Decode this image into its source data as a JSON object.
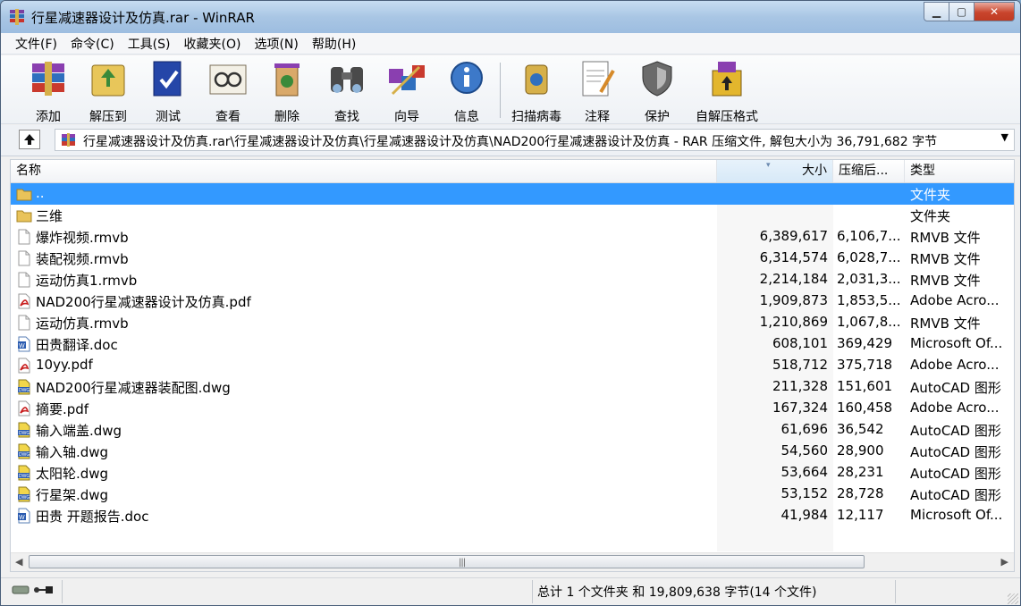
{
  "window": {
    "title": "行星减速器设计及仿真.rar - WinRAR"
  },
  "menu": [
    "文件(F)",
    "命令(C)",
    "工具(S)",
    "收藏夹(O)",
    "选项(N)",
    "帮助(H)"
  ],
  "toolbar": [
    {
      "label": "添加",
      "icon": "add-archive-icon"
    },
    {
      "label": "解压到",
      "icon": "extract-to-icon"
    },
    {
      "label": "测试",
      "icon": "test-icon"
    },
    {
      "label": "查看",
      "icon": "view-icon"
    },
    {
      "label": "删除",
      "icon": "delete-icon"
    },
    {
      "label": "查找",
      "icon": "find-icon"
    },
    {
      "label": "向导",
      "icon": "wizard-icon"
    },
    {
      "label": "信息",
      "icon": "info-icon"
    },
    {
      "label": "扫描病毒",
      "icon": "virus-scan-icon"
    },
    {
      "label": "注释",
      "icon": "comment-icon"
    },
    {
      "label": "保护",
      "icon": "protect-icon"
    },
    {
      "label": "自解压格式",
      "icon": "sfx-icon"
    }
  ],
  "address": {
    "path": "行星减速器设计及仿真.rar\\行星减速器设计及仿真\\行星减速器设计及仿真\\NAD200行星减速器设计及仿真 - RAR 压缩文件, 解包大小为 36,791,682 字节"
  },
  "columns": {
    "name": "名称",
    "size": "大小",
    "packed": "压缩后...",
    "type": "类型"
  },
  "files": [
    {
      "name": "..",
      "size": "",
      "packed": "",
      "type": "文件夹",
      "icon": "folder",
      "selected": true
    },
    {
      "name": "三维",
      "size": "",
      "packed": "",
      "type": "文件夹",
      "icon": "folder"
    },
    {
      "name": "爆炸视频.rmvb",
      "size": "6,389,617",
      "packed": "6,106,7...",
      "type": "RMVB 文件",
      "icon": "file"
    },
    {
      "name": "装配视频.rmvb",
      "size": "6,314,574",
      "packed": "6,028,7...",
      "type": "RMVB 文件",
      "icon": "file"
    },
    {
      "name": "运动仿真1.rmvb",
      "size": "2,214,184",
      "packed": "2,031,3...",
      "type": "RMVB 文件",
      "icon": "file"
    },
    {
      "name": "NAD200行星减速器设计及仿真.pdf",
      "size": "1,909,873",
      "packed": "1,853,5...",
      "type": "Adobe Acro...",
      "icon": "pdf"
    },
    {
      "name": "运动仿真.rmvb",
      "size": "1,210,869",
      "packed": "1,067,8...",
      "type": "RMVB 文件",
      "icon": "file"
    },
    {
      "name": "田贵翻译.doc",
      "size": "608,101",
      "packed": "369,429",
      "type": "Microsoft Of...",
      "icon": "doc"
    },
    {
      "name": "10yy.pdf",
      "size": "518,712",
      "packed": "375,718",
      "type": "Adobe Acro...",
      "icon": "pdf"
    },
    {
      "name": "NAD200行星减速器装配图.dwg",
      "size": "211,328",
      "packed": "151,601",
      "type": "AutoCAD 图形",
      "icon": "dwg"
    },
    {
      "name": "摘要.pdf",
      "size": "167,324",
      "packed": "160,458",
      "type": "Adobe Acro...",
      "icon": "pdf"
    },
    {
      "name": "输入端盖.dwg",
      "size": "61,696",
      "packed": "36,542",
      "type": "AutoCAD 图形",
      "icon": "dwg"
    },
    {
      "name": "输入轴.dwg",
      "size": "54,560",
      "packed": "28,900",
      "type": "AutoCAD 图形",
      "icon": "dwg"
    },
    {
      "name": "太阳轮.dwg",
      "size": "53,664",
      "packed": "28,231",
      "type": "AutoCAD 图形",
      "icon": "dwg"
    },
    {
      "name": "行星架.dwg",
      "size": "53,152",
      "packed": "28,728",
      "type": "AutoCAD 图形",
      "icon": "dwg"
    },
    {
      "name": "田贵 开题报告.doc",
      "size": "41,984",
      "packed": "12,117",
      "type": "Microsoft Of...",
      "icon": "doc"
    }
  ],
  "status": {
    "summary": "总计 1 个文件夹 和 19,809,638 字节(14 个文件)"
  },
  "colors": {
    "selection": "#3399ff",
    "titlebar": "#a9c6e4"
  }
}
